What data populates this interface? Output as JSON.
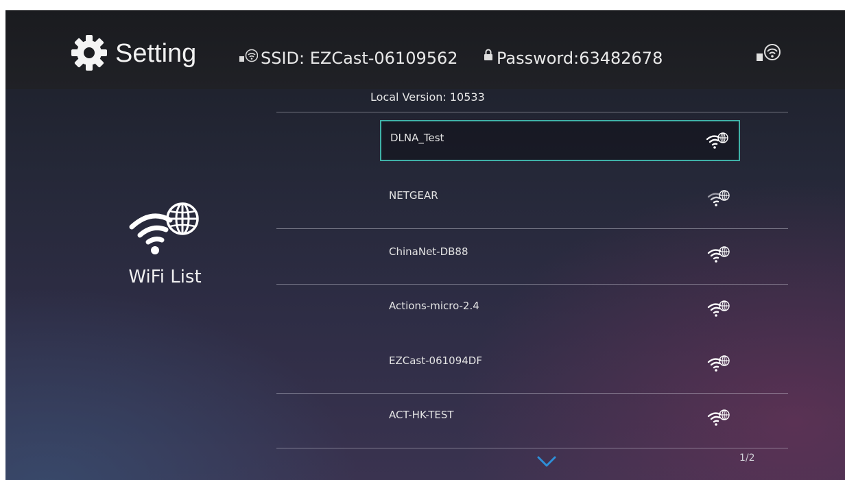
{
  "header": {
    "title": "Setting",
    "ssid": "SSID: EZCast-06109562",
    "password": "Password:63482678"
  },
  "version_label": "Local Version: 10533",
  "sidebar": {
    "label": "WiFi List"
  },
  "networks": [
    {
      "name": "DLNA_Test",
      "selected": true
    },
    {
      "name": "NETGEAR"
    },
    {
      "name": "ChinaNet-DB88"
    },
    {
      "name": "Actions-micro-2.4"
    },
    {
      "name": "EZCast-061094DF"
    },
    {
      "name": "ACT-HK-TEST"
    }
  ],
  "pagination": {
    "page": "1/2"
  },
  "colors": {
    "selection_border": "#3fb1a7",
    "chevron": "#2e8fd8"
  },
  "icons": [
    "gear-icon",
    "wifi-icon",
    "lock-icon",
    "hotspot-icon",
    "wifi-globe-icon",
    "chevron-down-icon"
  ]
}
